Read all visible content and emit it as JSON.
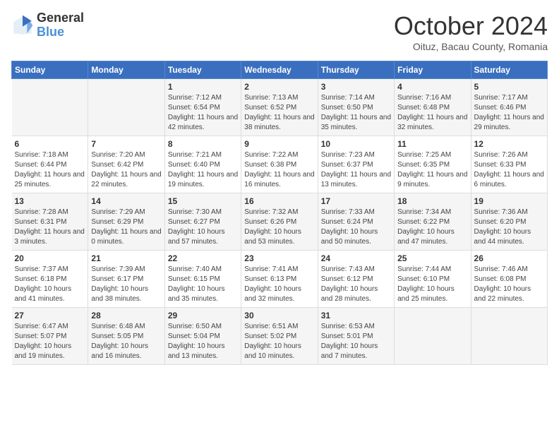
{
  "logo": {
    "general": "General",
    "blue": "Blue"
  },
  "title": "October 2024",
  "subtitle": "Oituz, Bacau County, Romania",
  "headers": [
    "Sunday",
    "Monday",
    "Tuesday",
    "Wednesday",
    "Thursday",
    "Friday",
    "Saturday"
  ],
  "weeks": [
    [
      {
        "day": "",
        "info": ""
      },
      {
        "day": "",
        "info": ""
      },
      {
        "day": "1",
        "info": "Sunrise: 7:12 AM\nSunset: 6:54 PM\nDaylight: 11 hours and 42 minutes."
      },
      {
        "day": "2",
        "info": "Sunrise: 7:13 AM\nSunset: 6:52 PM\nDaylight: 11 hours and 38 minutes."
      },
      {
        "day": "3",
        "info": "Sunrise: 7:14 AM\nSunset: 6:50 PM\nDaylight: 11 hours and 35 minutes."
      },
      {
        "day": "4",
        "info": "Sunrise: 7:16 AM\nSunset: 6:48 PM\nDaylight: 11 hours and 32 minutes."
      },
      {
        "day": "5",
        "info": "Sunrise: 7:17 AM\nSunset: 6:46 PM\nDaylight: 11 hours and 29 minutes."
      }
    ],
    [
      {
        "day": "6",
        "info": "Sunrise: 7:18 AM\nSunset: 6:44 PM\nDaylight: 11 hours and 25 minutes."
      },
      {
        "day": "7",
        "info": "Sunrise: 7:20 AM\nSunset: 6:42 PM\nDaylight: 11 hours and 22 minutes."
      },
      {
        "day": "8",
        "info": "Sunrise: 7:21 AM\nSunset: 6:40 PM\nDaylight: 11 hours and 19 minutes."
      },
      {
        "day": "9",
        "info": "Sunrise: 7:22 AM\nSunset: 6:38 PM\nDaylight: 11 hours and 16 minutes."
      },
      {
        "day": "10",
        "info": "Sunrise: 7:23 AM\nSunset: 6:37 PM\nDaylight: 11 hours and 13 minutes."
      },
      {
        "day": "11",
        "info": "Sunrise: 7:25 AM\nSunset: 6:35 PM\nDaylight: 11 hours and 9 minutes."
      },
      {
        "day": "12",
        "info": "Sunrise: 7:26 AM\nSunset: 6:33 PM\nDaylight: 11 hours and 6 minutes."
      }
    ],
    [
      {
        "day": "13",
        "info": "Sunrise: 7:28 AM\nSunset: 6:31 PM\nDaylight: 11 hours and 3 minutes."
      },
      {
        "day": "14",
        "info": "Sunrise: 7:29 AM\nSunset: 6:29 PM\nDaylight: 11 hours and 0 minutes."
      },
      {
        "day": "15",
        "info": "Sunrise: 7:30 AM\nSunset: 6:27 PM\nDaylight: 10 hours and 57 minutes."
      },
      {
        "day": "16",
        "info": "Sunrise: 7:32 AM\nSunset: 6:26 PM\nDaylight: 10 hours and 53 minutes."
      },
      {
        "day": "17",
        "info": "Sunrise: 7:33 AM\nSunset: 6:24 PM\nDaylight: 10 hours and 50 minutes."
      },
      {
        "day": "18",
        "info": "Sunrise: 7:34 AM\nSunset: 6:22 PM\nDaylight: 10 hours and 47 minutes."
      },
      {
        "day": "19",
        "info": "Sunrise: 7:36 AM\nSunset: 6:20 PM\nDaylight: 10 hours and 44 minutes."
      }
    ],
    [
      {
        "day": "20",
        "info": "Sunrise: 7:37 AM\nSunset: 6:18 PM\nDaylight: 10 hours and 41 minutes."
      },
      {
        "day": "21",
        "info": "Sunrise: 7:39 AM\nSunset: 6:17 PM\nDaylight: 10 hours and 38 minutes."
      },
      {
        "day": "22",
        "info": "Sunrise: 7:40 AM\nSunset: 6:15 PM\nDaylight: 10 hours and 35 minutes."
      },
      {
        "day": "23",
        "info": "Sunrise: 7:41 AM\nSunset: 6:13 PM\nDaylight: 10 hours and 32 minutes."
      },
      {
        "day": "24",
        "info": "Sunrise: 7:43 AM\nSunset: 6:12 PM\nDaylight: 10 hours and 28 minutes."
      },
      {
        "day": "25",
        "info": "Sunrise: 7:44 AM\nSunset: 6:10 PM\nDaylight: 10 hours and 25 minutes."
      },
      {
        "day": "26",
        "info": "Sunrise: 7:46 AM\nSunset: 6:08 PM\nDaylight: 10 hours and 22 minutes."
      }
    ],
    [
      {
        "day": "27",
        "info": "Sunrise: 6:47 AM\nSunset: 5:07 PM\nDaylight: 10 hours and 19 minutes."
      },
      {
        "day": "28",
        "info": "Sunrise: 6:48 AM\nSunset: 5:05 PM\nDaylight: 10 hours and 16 minutes."
      },
      {
        "day": "29",
        "info": "Sunrise: 6:50 AM\nSunset: 5:04 PM\nDaylight: 10 hours and 13 minutes."
      },
      {
        "day": "30",
        "info": "Sunrise: 6:51 AM\nSunset: 5:02 PM\nDaylight: 10 hours and 10 minutes."
      },
      {
        "day": "31",
        "info": "Sunrise: 6:53 AM\nSunset: 5:01 PM\nDaylight: 10 hours and 7 minutes."
      },
      {
        "day": "",
        "info": ""
      },
      {
        "day": "",
        "info": ""
      }
    ]
  ]
}
